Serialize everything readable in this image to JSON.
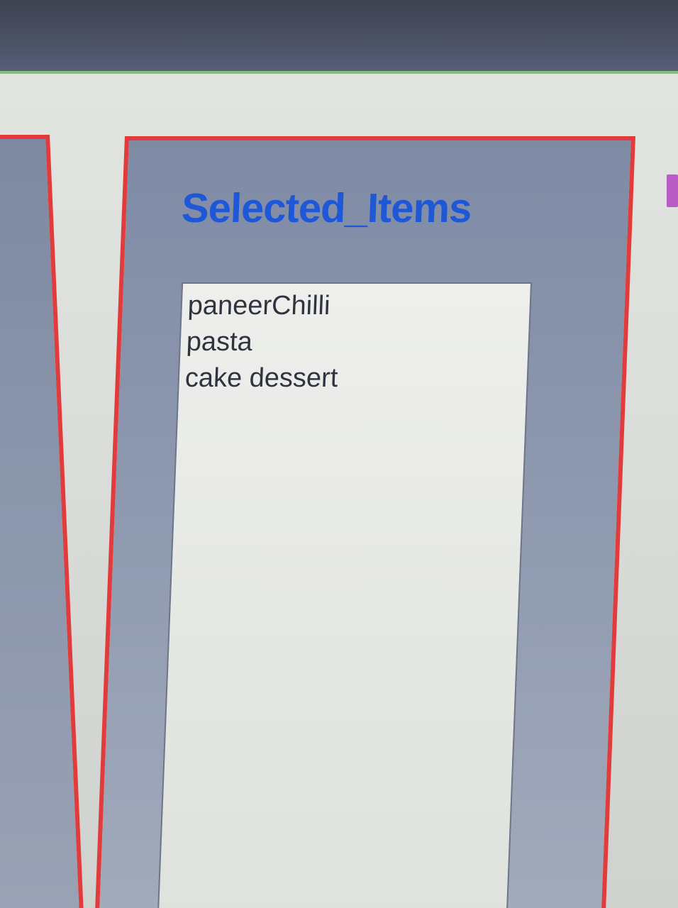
{
  "panel": {
    "title": "Selected_Items"
  },
  "selected_items": [
    "paneerChilli",
    "pasta",
    "cake dessert"
  ],
  "colors": {
    "panel_border": "#e23b3b",
    "title": "#1f58d6",
    "panel_fill": "#8c97ae",
    "listbox_fill": "#e6e8e4",
    "accent": "#b85dc4"
  }
}
